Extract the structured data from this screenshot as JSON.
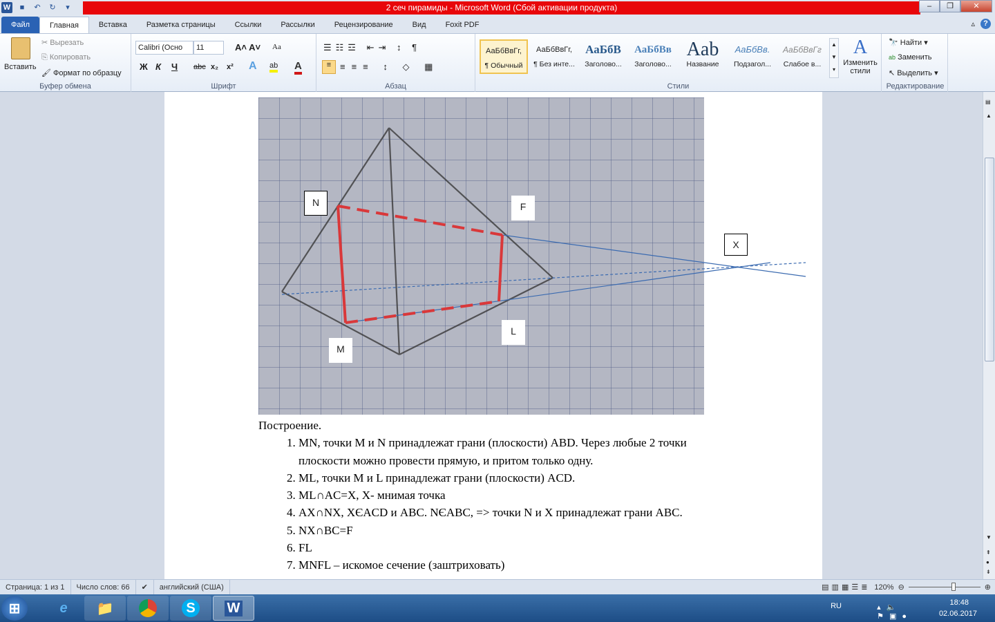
{
  "window": {
    "title": "2 сеч пирамиды  -  Microsoft Word (Сбой активации продукта)"
  },
  "tabs": [
    "Файл",
    "Главная",
    "Вставка",
    "Разметка страницы",
    "Ссылки",
    "Рассылки",
    "Рецензирование",
    "Вид",
    "Foxit PDF"
  ],
  "clipboard": {
    "paste": "Вставить",
    "cut": "Вырезать",
    "copy": "Копировать",
    "format_painter": "Формат по образцу",
    "label": "Буфер обмена"
  },
  "font": {
    "name": "Calibri (Осно",
    "size": "11",
    "label": "Шрифт",
    "bold": "Ж",
    "italic": "К",
    "underline": "Ч",
    "strike": "abc",
    "sub": "x₂",
    "sup": "x²",
    "case": "Aa"
  },
  "paragraph": {
    "label": "Абзац"
  },
  "styles": {
    "label": "Стили",
    "items": [
      {
        "sample": "АаБбВвГг,",
        "name": "¶ Обычный"
      },
      {
        "sample": "АаБбВвГг,",
        "name": "¶ Без инте..."
      },
      {
        "sample": "АаБбВ",
        "name": "Заголово..."
      },
      {
        "sample": "АаБбВв",
        "name": "Заголово..."
      },
      {
        "sample": "Aab",
        "name": "Название"
      },
      {
        "sample": "АаБбВв.",
        "name": "Подзагол..."
      },
      {
        "sample": "АаБбВвГг",
        "name": "Слабое в..."
      }
    ],
    "change": "Изменить стили"
  },
  "editing": {
    "label": "Редактирование",
    "find": "Найти",
    "replace": "Заменить",
    "select": "Выделить"
  },
  "figure": {
    "labels": {
      "N": "N",
      "F": "F",
      "X": "X",
      "M": "M",
      "L": "L"
    }
  },
  "document": {
    "heading": "Построение.",
    "items": [
      "MN, точки M и N принадлежат грани (плоскости) ABD. Через любые 2 точки плоскости можно провести прямую, и притом только одну.",
      "ML, точки M и L принадлежат грани (плоскости) ACD.",
      "ML∩AC=X, X- мнимая точка",
      "AX∩NX, XЄACD и ABC. NЄABC, => точки N и X принадлежат грани ABC.",
      "NX∩BC=F",
      "FL",
      "MNFL – искомое сечение (заштриховать)"
    ]
  },
  "status": {
    "page": "Страница: 1 из 1",
    "words": "Число слов: 66",
    "language": "английский (США)",
    "zoom": "120%"
  },
  "zoom_percent": 120,
  "tray": {
    "lang": "RU",
    "time": "18:48",
    "date": "02.06.2017"
  }
}
